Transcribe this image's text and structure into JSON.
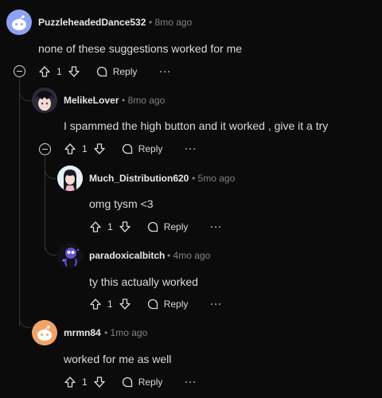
{
  "comments": [
    {
      "username": "PuzzleheadedDance532",
      "time": "8mo ago",
      "text": "none of these suggestions worked for me",
      "votes": "1",
      "reply": "Reply",
      "more": "···",
      "avatar_color": "#8ea2f5"
    },
    {
      "username": "MelikeLover",
      "time": "8mo ago",
      "text": "I spammed the high button and it worked , give it a try",
      "votes": "1",
      "reply": "Reply",
      "more": "···",
      "avatar_color": "#2b2b3a"
    },
    {
      "username": "Much_Distribution620",
      "time": "5mo ago",
      "text": "omg tysm <3",
      "votes": "1",
      "reply": "Reply",
      "more": "···",
      "avatar_color": "#cfe3f0"
    },
    {
      "username": "paradoxicalbitch",
      "time": "4mo ago",
      "text": "ty this actually worked",
      "votes": "1",
      "reply": "Reply",
      "more": "···",
      "avatar_color": "#3a2a6a"
    },
    {
      "username": "mrmn84",
      "time": "1mo ago",
      "text": "worked for me as well",
      "votes": "1",
      "reply": "Reply",
      "more": "···",
      "avatar_color": "#f0a46a"
    }
  ],
  "separator": "•"
}
